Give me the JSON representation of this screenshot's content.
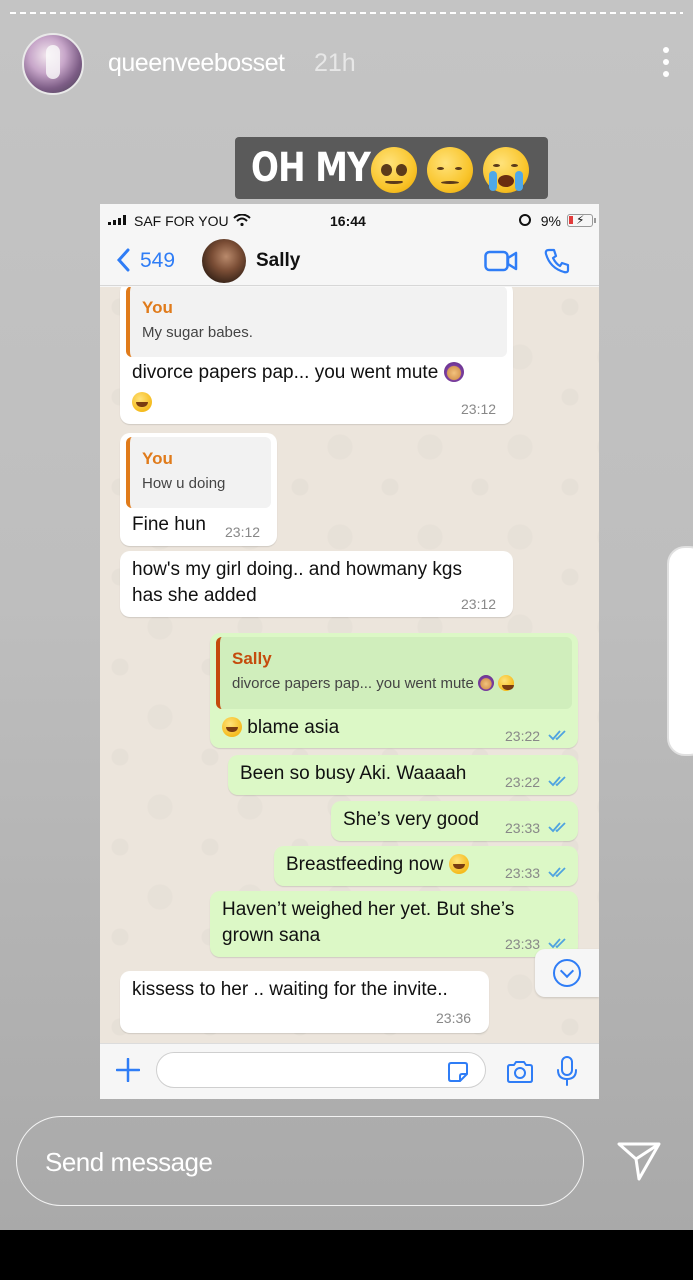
{
  "story": {
    "username": "queenveebosset",
    "time_ago": "21h",
    "sticker_text": "OH MY",
    "sticker_emojis": [
      "pleading-face",
      "pensive-face",
      "loudly-crying-face"
    ],
    "reply_placeholder": "Send message"
  },
  "phone": {
    "carrier": "SAF FOR YOU",
    "clock": "16:44",
    "battery": "9%",
    "back_count": "549",
    "contact_name": "Sally"
  },
  "messages": [
    {
      "dir": "in",
      "quote_name": "You",
      "quote_text": "My sugar babes.",
      "text": "divorce papers pap... you went mute",
      "emojis": [
        "woman-facepalming",
        "face-with-tears-of-joy"
      ],
      "time": "23:12"
    },
    {
      "dir": "in",
      "quote_name": "You",
      "quote_text": "How u doing",
      "text": "Fine hun",
      "time": "23:12"
    },
    {
      "dir": "in",
      "text_line1": "how's my girl doing.. and howmany kgs",
      "text_line2": "has she added",
      "time": "23:12"
    },
    {
      "dir": "out",
      "quote_name": "Sally",
      "quote_text": "divorce papers pap... you went mute",
      "text": "blame asia",
      "emojis": [
        "face-with-tears-of-joy"
      ],
      "time": "23:22",
      "read": true
    },
    {
      "dir": "out",
      "text": "Been so busy Aki. Waaaah",
      "time": "23:22",
      "read": true
    },
    {
      "dir": "out",
      "text": "She’s very good",
      "time": "23:33",
      "read": true
    },
    {
      "dir": "out",
      "text": "Breastfeeding now",
      "emojis": [
        "face-with-tears-of-joy"
      ],
      "time": "23:33",
      "read": true
    },
    {
      "dir": "out",
      "text_line1": "Haven’t weighed her yet. But she’s",
      "text_line2": "grown sana",
      "time": "23:33",
      "read": true
    },
    {
      "dir": "in",
      "text": "kissess to her .. waiting for the invite..",
      "time": "23:36"
    }
  ],
  "colors": {
    "incoming_bubble": "#ffffff",
    "outgoing_bubble": "#dcf8c6",
    "ios_blue": "#2f7df6",
    "quote_you": "#e07b1b",
    "quote_sally": "#c44b0c",
    "read_ticks": "#4fa3e0"
  }
}
